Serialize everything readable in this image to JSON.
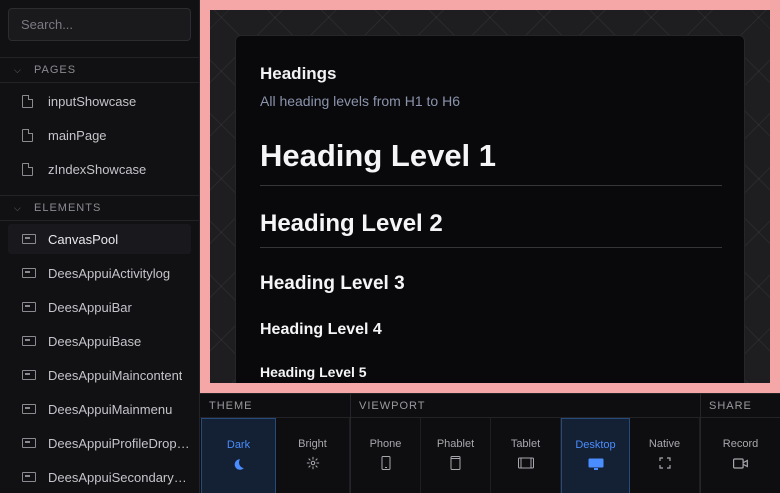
{
  "sidebar": {
    "search_placeholder": "Search...",
    "pages_header": "PAGES",
    "pages": [
      {
        "label": "inputShowcase"
      },
      {
        "label": "mainPage"
      },
      {
        "label": "zIndexShowcase"
      }
    ],
    "elements_header": "ELEMENTS",
    "elements": [
      {
        "label": "CanvasPool"
      },
      {
        "label": "DeesAppuiActivitylog"
      },
      {
        "label": "DeesAppuiBar"
      },
      {
        "label": "DeesAppuiBase"
      },
      {
        "label": "DeesAppuiMaincontent"
      },
      {
        "label": "DeesAppuiMainmenu"
      },
      {
        "label": "DeesAppuiProfileDropdown"
      },
      {
        "label": "DeesAppuiSecondarymenu"
      }
    ]
  },
  "preview": {
    "card_title": "Headings",
    "card_subtitle": "All heading levels from H1 to H6",
    "h1": "Heading Level 1",
    "h2": "Heading Level 2",
    "h3": "Heading Level 3",
    "h4": "Heading Level 4",
    "h5": "Heading Level 5",
    "frame_color": "#f5a6a6"
  },
  "toolbar": {
    "theme_label": "THEME",
    "viewport_label": "VIEWPORT",
    "share_label": "SHARE",
    "theme_buttons": [
      {
        "label": "Dark",
        "icon": "moon-icon",
        "active": true
      },
      {
        "label": "Bright",
        "icon": "sun-icon",
        "active": false
      }
    ],
    "viewport_buttons": [
      {
        "label": "Phone",
        "icon": "phone-icon",
        "active": false
      },
      {
        "label": "Phablet",
        "icon": "phablet-icon",
        "active": false
      },
      {
        "label": "Tablet",
        "icon": "tablet-icon",
        "active": false
      },
      {
        "label": "Desktop",
        "icon": "desktop-icon",
        "active": true
      },
      {
        "label": "Native",
        "icon": "fullscreen-icon",
        "active": false
      }
    ],
    "share_buttons": [
      {
        "label": "Record",
        "icon": "video-icon",
        "active": false
      }
    ],
    "accent_color": "#4a8dff"
  }
}
